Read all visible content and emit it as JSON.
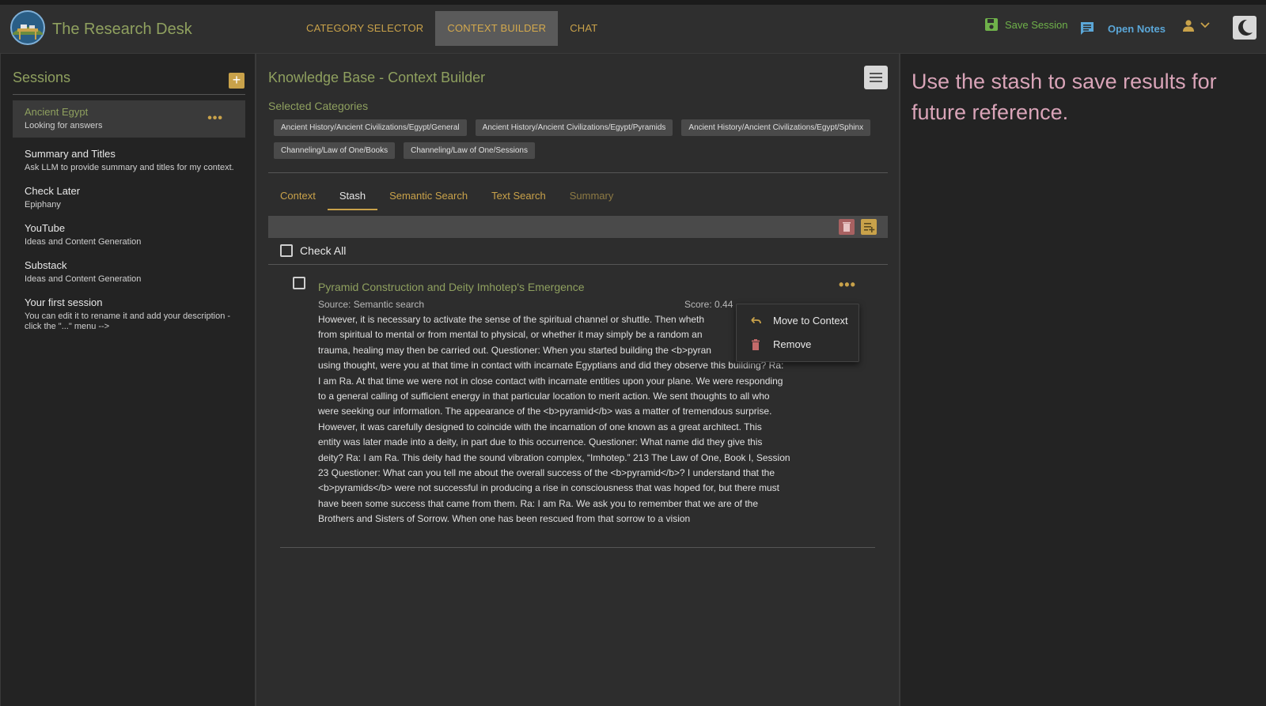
{
  "app": {
    "title": "The Research Desk",
    "logo_icon": "research-desk-logo"
  },
  "nav": {
    "tabs": [
      {
        "label": "CATEGORY SELECTOR"
      },
      {
        "label": "CONTEXT BUILDER",
        "active": true
      },
      {
        "label": "CHAT"
      }
    ]
  },
  "header_actions": {
    "save_session": "Save Session",
    "open_notes": "Open Notes"
  },
  "sidebar": {
    "title": "Sessions",
    "add_label": "+",
    "sessions": [
      {
        "name": "Ancient Egypt",
        "desc": "Looking for answers",
        "active": true
      },
      {
        "name": "Summary and Titles",
        "desc": "Ask LLM to provide summary and titles for my context."
      },
      {
        "name": "Check Later",
        "desc": "Epiphany"
      },
      {
        "name": "YouTube",
        "desc": "Ideas and Content Generation"
      },
      {
        "name": "Substack",
        "desc": "Ideas and Content Generation"
      },
      {
        "name": "Your first session",
        "desc": "You can edit it to rename it and add your description - click the \"...\" menu -->"
      }
    ]
  },
  "main": {
    "title": "Knowledge Base - Context Builder",
    "categories_title": "Selected Categories",
    "categories": [
      "Ancient History/Ancient Civilizations/Egypt/General",
      "Ancient History/Ancient Civilizations/Egypt/Pyramids",
      "Ancient History/Ancient Civilizations/Egypt/Sphinx",
      "Channeling/Law of One/Books",
      "Channeling/Law of One/Sessions"
    ],
    "tabs": [
      {
        "label": "Context"
      },
      {
        "label": "Stash",
        "active": true
      },
      {
        "label": "Semantic Search"
      },
      {
        "label": "Text Search"
      },
      {
        "label": "Summary",
        "dim": true
      }
    ],
    "check_all": "Check All",
    "result": {
      "title": "Pyramid Construction and Deity Imhotep's Emergence",
      "source": "Source: Semantic search",
      "score": "Score: 0.44",
      "text_lines": [
        "However, it is necessary to activate the sense of the spiritual channel or shuttle. Then wheth",
        "from spiritual to mental or from mental to physical, or whether it may simply be a random an",
        "trauma, healing may then be carried out. Questioner: When you started building the <b>pyran",
        "using thought, were you at that time in contact with incarnate Egyptians and did they observe this building? Ra:",
        "I am Ra. At that time we were not in close contact with incarnate entities upon your plane. We were responding",
        "to a general calling of sufficient energy in that particular location to merit action. We sent thoughts to all who",
        "were seeking our information. The appearance of the <b>pyramid</b> was a matter of tremendous surprise.",
        "However, it was carefully designed to coincide with the incarnation of one known as a great architect. This",
        "entity was later made into a deity, in part due to this occurrence. Questioner: What name did they give this",
        "deity? Ra: I am Ra. This deity had the sound vibration complex, “Imhotep.” 213 The Law of One, Book I, Session",
        "23 Questioner: What can you tell me about the overall success of the <b>pyramid</b>? I understand that the",
        "<b>pyramids</b> were not successful in producing a rise in consciousness that was hoped for, but there must",
        "have been some success that came from them. Ra: I am Ra. We ask you to remember that we are of the",
        "Brothers and Sisters of Sorrow. When one has been rescued from that sorrow to a vision"
      ]
    }
  },
  "context_menu": {
    "items": [
      {
        "label": "Move to Context",
        "icon": "undo-arrow-icon"
      },
      {
        "label": "Remove",
        "icon": "trash-icon"
      }
    ]
  },
  "right_panel": {
    "help_text": "Use the stash to save results for future reference."
  },
  "colors": {
    "accent_gold": "#c9a24a",
    "accent_green": "#8fa05f",
    "save_green": "#6fb14a",
    "notes_blue": "#5ba7d8",
    "help_pink": "#d9a4b8"
  }
}
